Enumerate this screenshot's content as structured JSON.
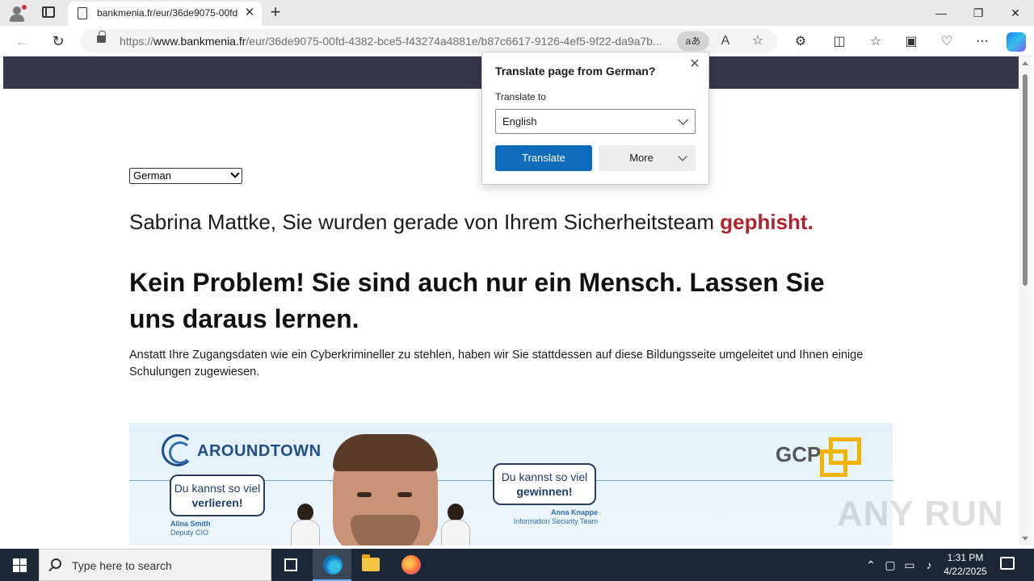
{
  "browser": {
    "tab_title": "bankmenia.fr/eur/36de9075-00fd",
    "url_prefix": "https://",
    "url_host": "www.bankmenia.fr",
    "url_path": "/eur/36de9075-00fd-4382-bce5-f43274a4881e/b87c6617-9126-4ef5-9f22-da9a7b...",
    "translate_pill": "aあ"
  },
  "page": {
    "language_select": "German",
    "phished_prefix": "Sabrina Mattke, Sie wurden gerade von Ihrem Sicherheitsteam ",
    "phished_accent": "gephisht.",
    "headline": "Kein Problem! Sie sind auch nur ein Mensch. Lassen Sie uns daraus lernen.",
    "body": "Anstatt Ihre Zugangsdaten wie ein Cyberkrimineller zu stehlen, haben wir Sie stattdessen auf diese Bildungsseite umgeleitet und Ihnen einige Schulungen zugewiesen.",
    "accent_color": "#b2222e"
  },
  "banner": {
    "logo_left": "AROUNDTOWN",
    "logo_right": "GCP",
    "bubble_left_line1": "Du kannst so viel",
    "bubble_left_line2": "verlieren!",
    "bubble_right_line1": "Du kannst so viel",
    "bubble_right_line2": "gewinnen!",
    "person_left_name": "Alina Smith",
    "person_left_role": "Deputy CIO",
    "person_right_name": "Anna Knappe",
    "person_right_role": "Information Security Team"
  },
  "translate_popup": {
    "title": "Translate page from German?",
    "label": "Translate to",
    "selected_language": "English",
    "primary_button": "Translate",
    "more_button": "More"
  },
  "watermark": "ANY RUN",
  "taskbar": {
    "search_placeholder": "Type here to search",
    "time": "1:31 PM",
    "date": "4/22/2025"
  }
}
